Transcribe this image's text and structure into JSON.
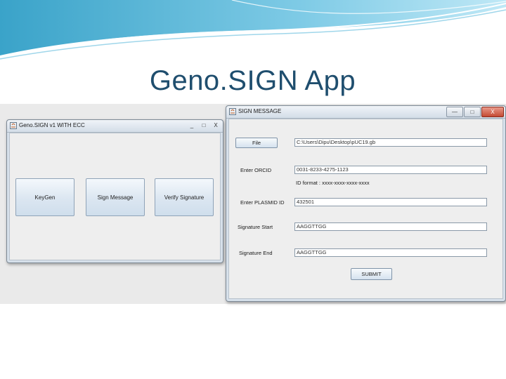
{
  "slide": {
    "title": "Geno.SIGN App"
  },
  "main_window": {
    "title": "Geno.SIGN v1 WITH ECC",
    "controls": {
      "minimize": "_",
      "maximize": "□",
      "close": "X"
    },
    "buttons": {
      "keygen": "KeyGen",
      "sign": "Sign Message",
      "verify": "Verify Signature"
    }
  },
  "sign_window": {
    "title": "SIGN MESSAGE",
    "controls": {
      "minimize": "—",
      "maximize": "□",
      "close": "X"
    },
    "file_button": "File",
    "file_path": "C:\\Users\\Dipu\\Desktop\\pUC19.gb",
    "orcid_label": "Enter ORCID",
    "orcid_value": "0031-8233-4275-1123",
    "id_format": "ID format : xxxx-xxxx-xxxx-xxxx",
    "plasmid_label": "Enter PLASMID ID",
    "plasmid_value": "432501",
    "sig_start_label": "Signature Start",
    "sig_start_value": "AAGGTTGG",
    "sig_end_label": "Signature End",
    "sig_end_value": "AAGGTTGG",
    "submit_label": "SUBMIT"
  },
  "colors": {
    "title": "#1f4e6e",
    "wave_dark": "#2b8fb8",
    "wave_light": "#aee0f2"
  }
}
